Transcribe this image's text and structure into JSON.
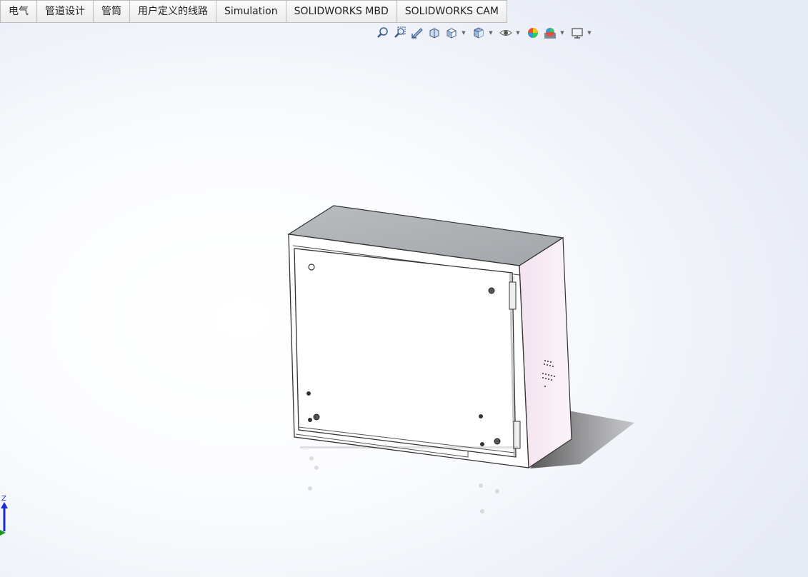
{
  "tabs": [
    {
      "label": "电气"
    },
    {
      "label": "管道设计"
    },
    {
      "label": "管筒"
    },
    {
      "label": "用户定义的线路"
    },
    {
      "label": "Simulation"
    },
    {
      "label": "SOLIDWORKS MBD"
    },
    {
      "label": "SOLIDWORKS CAM"
    }
  ],
  "heads_up_toolbar": [
    "zoom-to-fit-icon",
    "zoom-to-area-icon",
    "previous-view-icon",
    "section-view-icon",
    "view-orientation-icon",
    "display-style-icon",
    "hide-show-items-icon",
    "edit-appearance-icon",
    "apply-scene-icon",
    "view-settings-icon"
  ],
  "triad": {
    "z_label": "Z"
  },
  "colors": {
    "tab_bg": "#f0f0f0",
    "axis_z": "#1f2bd6",
    "axis_y": "#1a9a1a",
    "cabinet_side": "#f6e8f2"
  }
}
